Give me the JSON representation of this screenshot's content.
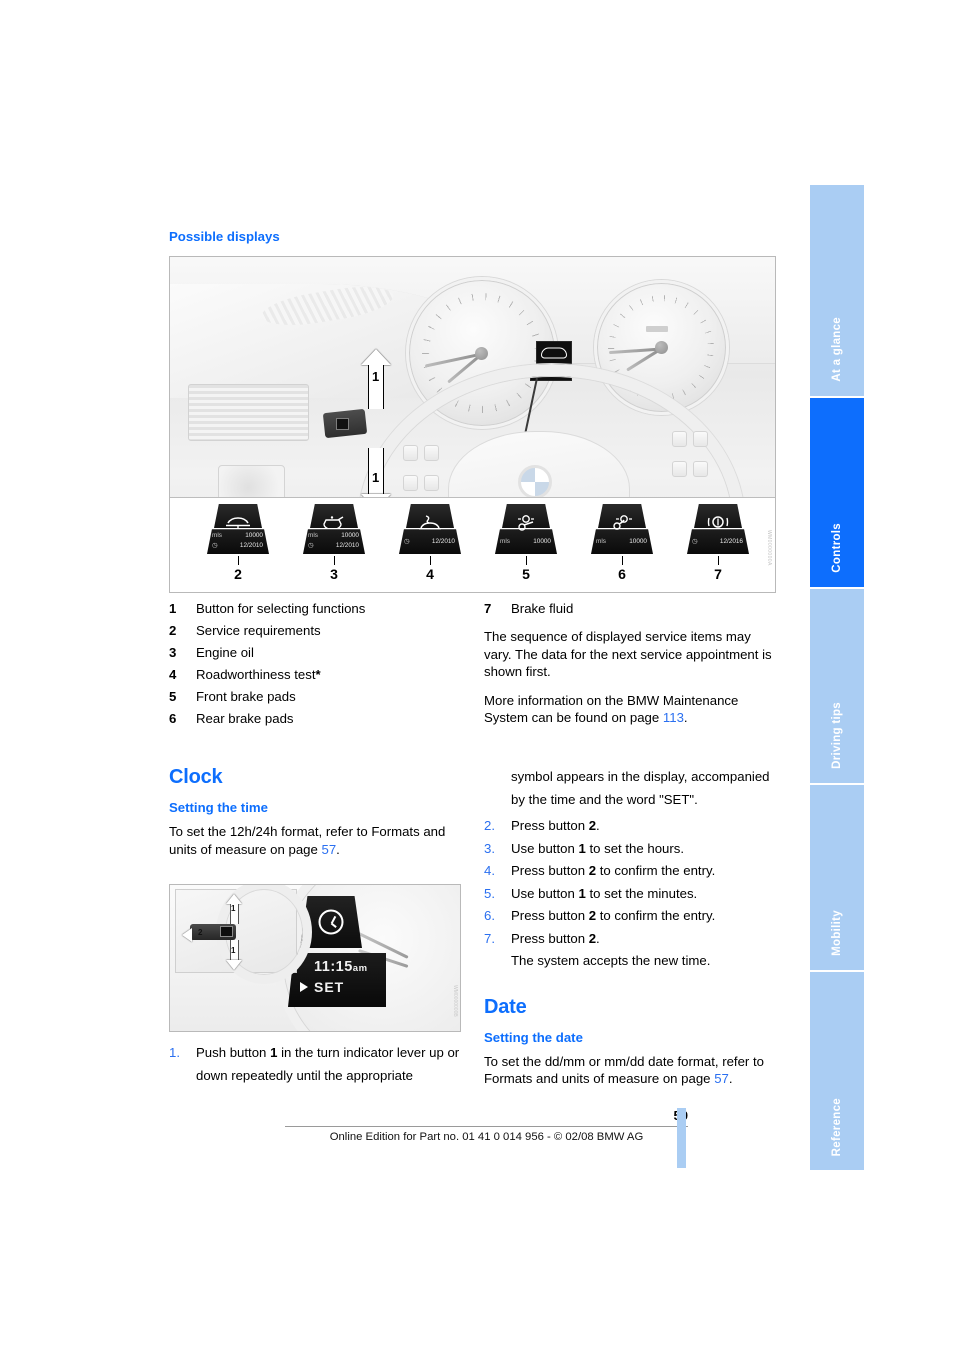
{
  "page": {
    "number": "59",
    "footer_text": "Online Edition for Part no. 01 41 0 014 956 - © 02/08 BMW AG"
  },
  "side_tabs": [
    {
      "label": "At a glance",
      "active": false
    },
    {
      "label": "Controls",
      "active": true
    },
    {
      "label": "Driving tips",
      "active": false
    },
    {
      "label": "Mobility",
      "active": false
    },
    {
      "label": "Reference",
      "active": false
    }
  ],
  "sections": {
    "possible_displays": {
      "heading": "Possible displays",
      "figure_code": "WM0000000A",
      "callouts": {
        "lever_up": "1",
        "lever_down": "1"
      },
      "service_icons": [
        {
          "num": "2",
          "glyph": "car-lift-icon",
          "unit": "mls",
          "distance": "10000",
          "date": "12/2010"
        },
        {
          "num": "3",
          "glyph": "oil-can-icon",
          "unit": "mls",
          "distance": "10000",
          "date": "12/2010"
        },
        {
          "num": "4",
          "glyph": "car-check-icon",
          "unit": "",
          "distance": "",
          "date": "12/2010"
        },
        {
          "num": "5",
          "glyph": "front-brake-icon",
          "unit": "mls",
          "distance": "10000",
          "date": ""
        },
        {
          "num": "6",
          "glyph": "rear-brake-icon",
          "unit": "mls",
          "distance": "10000",
          "date": ""
        },
        {
          "num": "7",
          "glyph": "brake-fluid-icon",
          "unit": "",
          "distance": "",
          "date": "12/2016"
        }
      ],
      "legend_left": [
        {
          "num": "1",
          "text": "Button for selecting functions"
        },
        {
          "num": "2",
          "text": "Service requirements"
        },
        {
          "num": "3",
          "text": "Engine oil"
        },
        {
          "num": "4",
          "text": "Roadworthiness test",
          "asterisk": "*"
        },
        {
          "num": "5",
          "text": "Front brake pads"
        },
        {
          "num": "6",
          "text": "Rear brake pads"
        }
      ],
      "legend_right": [
        {
          "num": "7",
          "text": "Brake fluid"
        }
      ],
      "paragraph_1": "The sequence of displayed service items may vary. The data for the next service appointment is shown first.",
      "paragraph_2_pre": "More information on the BMW Maintenance System can be found on page ",
      "paragraph_2_link": "113",
      "paragraph_2_post": "."
    },
    "clock": {
      "heading": "Clock",
      "subheading": "Setting the time",
      "intro_pre": "To set the 12h/24h format, refer to Formats and units of measure on page ",
      "intro_link": "57",
      "intro_post": ".",
      "figure": {
        "code": "WM0000000B",
        "time": "11:15",
        "ampm": "am",
        "set_label": "SET",
        "callout_1": "1",
        "callout_2": "2"
      },
      "steps": [
        {
          "num": "1.",
          "text": "Push button 1 in the turn indicator lever up or down repeatedly until the appropriate symbol appears in the display, accompanied by the time and the word \"SET\"."
        },
        {
          "num": "2.",
          "text": "Press button 2."
        },
        {
          "num": "3.",
          "text": "Use button 1 to set the hours."
        },
        {
          "num": "4.",
          "text": "Press button 2 to confirm the entry."
        },
        {
          "num": "5.",
          "text": "Use button 1 to set the minutes."
        },
        {
          "num": "6.",
          "text": "Press button 2 to confirm the entry."
        },
        {
          "num": "7.",
          "text": "Press button 2.",
          "extra": "The system accepts the new time."
        }
      ]
    },
    "date": {
      "heading": "Date",
      "subheading": "Setting the date",
      "intro_pre": "To set the dd/mm or mm/dd date format, refer to Formats and units of measure on page ",
      "intro_link": "57",
      "intro_post": "."
    }
  },
  "colors": {
    "accent_blue": "#0d6efd",
    "tab_inactive": "#aacdf3",
    "link_blue": "#2a6ff0"
  }
}
